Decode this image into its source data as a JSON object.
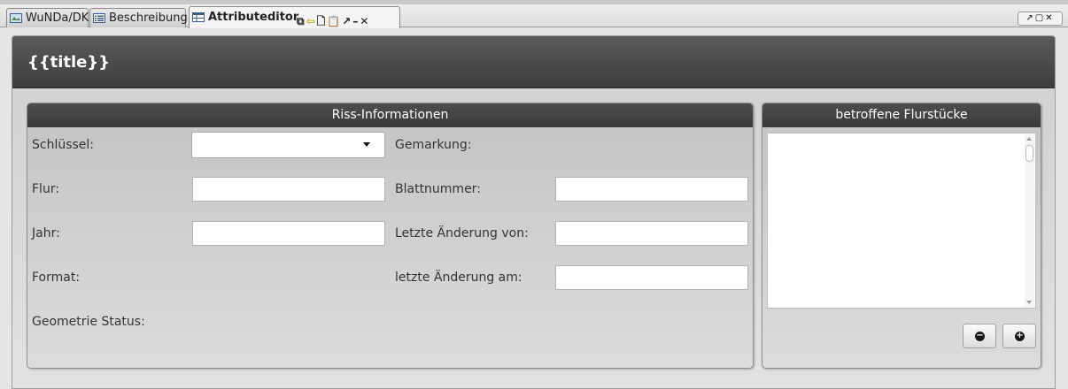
{
  "tabs": [
    {
      "label": "WuNDa/DK",
      "icon": "map-window-icon",
      "active": false
    },
    {
      "label": "Beschreibung",
      "icon": "list-icon",
      "active": false
    },
    {
      "label": "Attributeditor",
      "icon": "table-icon",
      "active": true
    }
  ],
  "tab_tools": {
    "copy_icon": "⧉",
    "back_icon": "⇦",
    "page_icon": "🗋",
    "paste_icon": "📋",
    "pin_icon": "↗",
    "minimize_icon": "–",
    "close_icon": "✕"
  },
  "window_controls": "↗▢✕",
  "panel": {
    "title": "{{title}}"
  },
  "riss": {
    "header": "Riss-Informationen",
    "schluessel_label": "Schlüssel:",
    "schluessel_value": "",
    "flur_label": "Flur:",
    "flur_value": "",
    "jahr_label": "Jahr:",
    "jahr_value": "",
    "format_label": "Format:",
    "geometrie_label": "Geometrie Status:",
    "gemarkung_label": "Gemarkung:",
    "blattnummer_label": "Blattnummer:",
    "blattnummer_value": "",
    "letzte_aenderung_von_label": "Letzte Änderung von:",
    "letzte_aenderung_von_value": "",
    "letzte_aenderung_am_label": "letzte Änderung am:",
    "letzte_aenderung_am_value": ""
  },
  "flurstuecke": {
    "header": "betroffene Flurstücke",
    "items": [],
    "remove_symbol": "−",
    "add_symbol": "+"
  },
  "colors": {
    "header_dark": "#3e3e3e",
    "panel_bg": "#d6d6d6",
    "field_bg": "#ffffff"
  }
}
